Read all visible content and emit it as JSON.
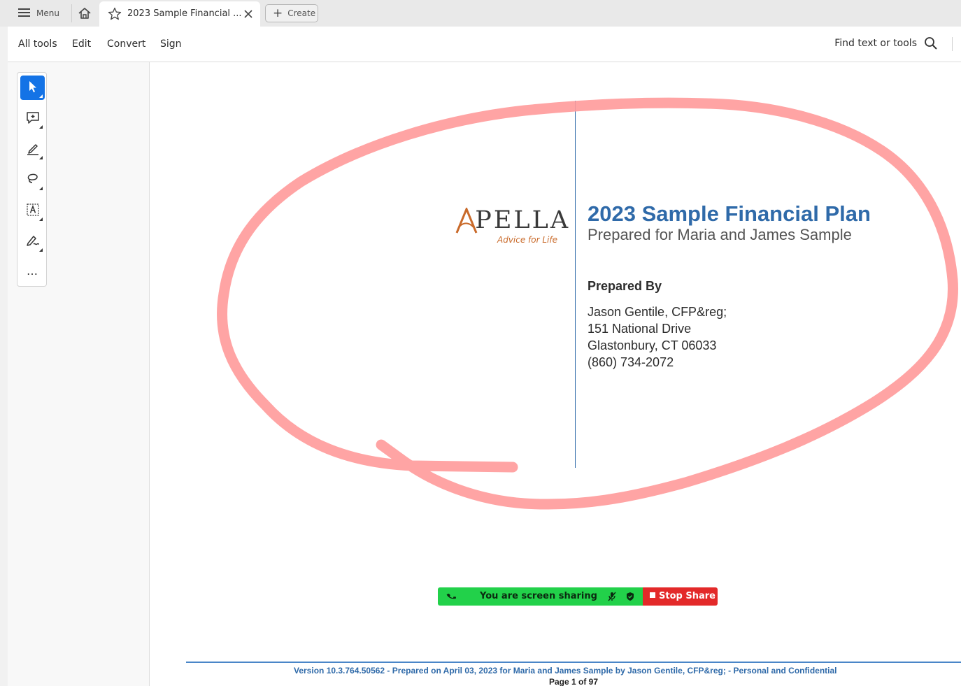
{
  "tabbar": {
    "menu_label": "Menu",
    "menu_icon": "hamburger-icon",
    "home_icon": "home-icon",
    "tab_title": "2023 Sample Financial ...",
    "tab_star_icon": "star-icon",
    "tab_close_icon": "close-icon",
    "create_label": "Create"
  },
  "toolbar": {
    "items": [
      "All tools",
      "Edit",
      "Convert",
      "Sign"
    ],
    "find_label": "Find text or tools",
    "find_icon": "search-icon"
  },
  "tool_rail": {
    "tools": [
      "select-icon",
      "add-comment-icon",
      "highlight-pen-icon",
      "lasso-icon",
      "text-select-icon",
      "sign-icon",
      "more-icon"
    ],
    "active": "select-icon",
    "more_label": "…"
  },
  "document": {
    "logo_text": "APELLA",
    "logo_tagline": "Advice for Life",
    "title": "2023 Sample Financial Plan",
    "subtitle": "Prepared for Maria and James Sample",
    "prepared_by_heading": "Prepared By",
    "prepared_by_lines": [
      "Jason Gentile, CFP&reg;",
      "151 National Drive",
      "Glastonbury, CT 06033",
      "(860) 734-2072"
    ],
    "footer_text": "Version 10.3.764.50562 - Prepared on April 03, 2023 for Maria and James Sample by Jason Gentile, CFP&reg; - Personal and Confidential",
    "page_label": "Page 1 of 97"
  },
  "screen_share": {
    "status_text": "You are screen sharing",
    "stop_label": "Stop Share",
    "status_color": "#22d14a",
    "stop_color": "#e32929"
  },
  "colors": {
    "accent": "#1473e6",
    "doc_blue": "#2f6aa9",
    "annotation": "#ff9a9a",
    "logo_orange": "#c96a2a"
  }
}
